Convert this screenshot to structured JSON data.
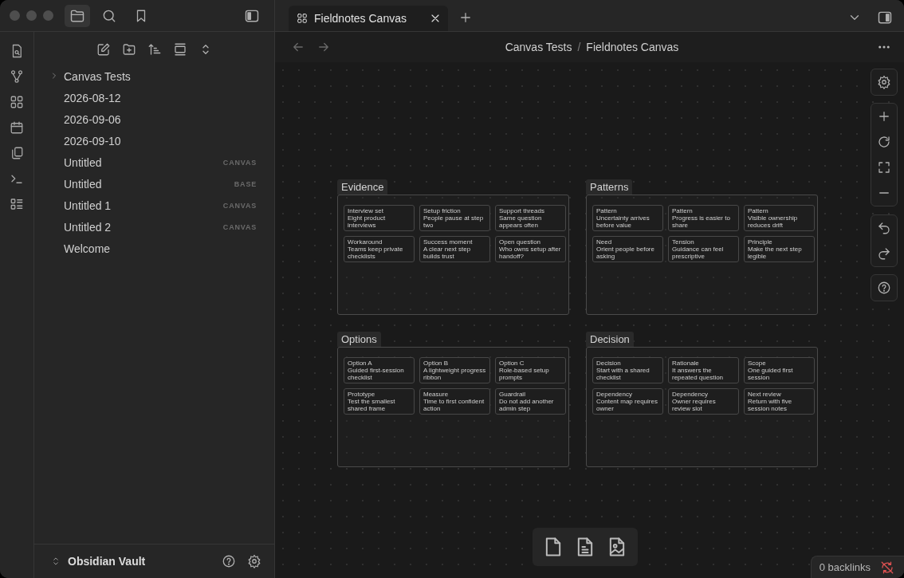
{
  "tabs": [
    {
      "label": "Fieldnotes Canvas",
      "selected": true
    }
  ],
  "file_explorer": {
    "items": [
      {
        "name": "Canvas Tests",
        "kind": "folder",
        "expanded": false
      },
      {
        "name": "2026-08-12",
        "kind": "file"
      },
      {
        "name": "2026-09-06",
        "kind": "file"
      },
      {
        "name": "2026-09-10",
        "kind": "file"
      },
      {
        "name": "Untitled",
        "kind": "file",
        "badge": "CANVAS"
      },
      {
        "name": "Untitled",
        "kind": "file",
        "badge": "BASE"
      },
      {
        "name": "Untitled 1",
        "kind": "file",
        "badge": "CANVAS"
      },
      {
        "name": "Untitled 2",
        "kind": "file",
        "badge": "CANVAS"
      },
      {
        "name": "Welcome",
        "kind": "file"
      }
    ]
  },
  "vault": {
    "name": "Obsidian Vault"
  },
  "breadcrumb": {
    "parts": [
      "Canvas Tests",
      "Fieldnotes Canvas"
    ],
    "separator": "/"
  },
  "canvas": {
    "groups": [
      {
        "label": "Evidence",
        "cards": [
          {
            "title": "Interview set",
            "body": "Eight product interviews"
          },
          {
            "title": "Setup friction",
            "body": "People pause at step two"
          },
          {
            "title": "Support threads",
            "body": "Same question appears often"
          },
          {
            "title": "Workaround",
            "body": "Teams keep private checklists"
          },
          {
            "title": "Success moment",
            "body": "A clear next step builds trust"
          },
          {
            "title": "Open question",
            "body": "Who owns setup after handoff?"
          }
        ]
      },
      {
        "label": "Patterns",
        "cards": [
          {
            "title": "Pattern",
            "body": "Uncertainty arrives before value"
          },
          {
            "title": "Pattern",
            "body": "Progress is easier to share"
          },
          {
            "title": "Pattern",
            "body": "Visible ownership reduces drift"
          },
          {
            "title": "Need",
            "body": "Orient people before asking"
          },
          {
            "title": "Tension",
            "body": "Guidance can feel prescriptive"
          },
          {
            "title": "Principle",
            "body": "Make the next step legible"
          }
        ]
      },
      {
        "label": "Options",
        "cards": [
          {
            "title": "Option A",
            "body": "Guided first-session checklist"
          },
          {
            "title": "Option B",
            "body": "A lightweight progress ribbon"
          },
          {
            "title": "Option C",
            "body": "Role-based setup prompts"
          },
          {
            "title": "Prototype",
            "body": "Test the smallest shared frame"
          },
          {
            "title": "Measure",
            "body": "Time to first confident action"
          },
          {
            "title": "Guardrail",
            "body": "Do not add another admin step"
          }
        ]
      },
      {
        "label": "Decision",
        "cards": [
          {
            "title": "Decision",
            "body": "Start with a shared checklist"
          },
          {
            "title": "Rationale",
            "body": "It answers the repeated question"
          },
          {
            "title": "Scope",
            "body": "One guided first session"
          },
          {
            "title": "Dependency",
            "body": "Content map requires owner"
          },
          {
            "title": "Dependency",
            "body": "Owner requires review slot"
          },
          {
            "title": "Next review",
            "body": "Return with five session notes"
          }
        ]
      }
    ]
  },
  "status_bar": {
    "backlinks": "0 backlinks"
  }
}
